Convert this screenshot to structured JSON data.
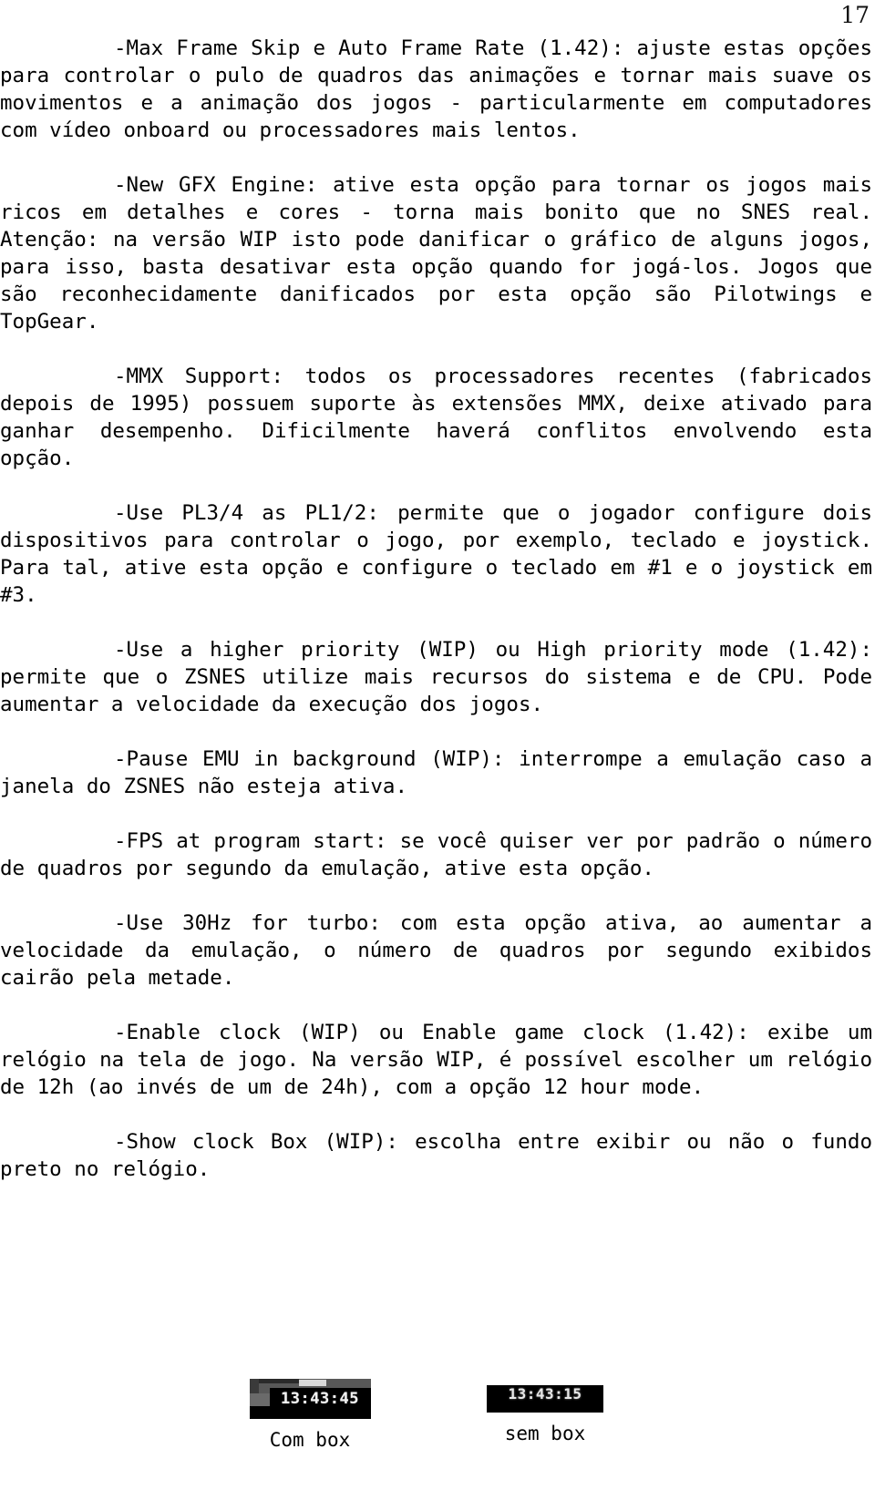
{
  "page": {
    "number": "17"
  },
  "paragraphs": [
    {
      "id": "max-frame-skip",
      "text": "-Max Frame Skip e Auto Frame Rate (1.42): ajuste estas opções para controlar o pulo de quadros das animações e tornar mais suave os movimentos e a animação dos jogos - particularmente em computadores com vídeo onboard ou processadores mais lentos."
    },
    {
      "id": "new-gfx-engine",
      "text": "-New GFX Engine: ative esta opção para tornar os jogos mais ricos em detalhes e cores - torna mais bonito que no SNES real. Atenção: na versão WIP isto pode danificar o gráfico de alguns jogos, para isso, basta desativar esta opção quando for jogá-los. Jogos que são reconhecidamente danificados por esta opção são Pilotwings e TopGear."
    },
    {
      "id": "mmx-support",
      "text": "-MMX Support: todos os processadores recentes (fabricados depois de 1995) possuem suporte às extensões MMX, deixe ativado para ganhar desempenho. Dificilmente haverá conflitos envolvendo esta opção."
    },
    {
      "id": "use-pl34-as-pl12",
      "text": "-Use PL3/4 as PL1/2: permite que o jogador configure dois dispositivos para controlar o jogo, por exemplo, teclado e joystick. Para tal, ative esta opção e configure o teclado em #1 e o joystick em #3."
    },
    {
      "id": "higher-priority",
      "text": "-Use a higher priority (WIP) ou High priority mode (1.42): permite que o ZSNES utilize mais recursos do sistema e de CPU. Pode aumentar a velocidade da execução dos jogos."
    },
    {
      "id": "pause-emu-background",
      "text": "-Pause EMU in background (WIP): interrompe a emulação caso a janela do ZSNES não esteja ativa."
    },
    {
      "id": "fps-at-program-start",
      "text": "-FPS at program start: se você quiser ver por padrão o número de quadros por segundo da emulação, ative esta opção."
    },
    {
      "id": "use-30hz-for-turbo",
      "text": "-Use 30Hz for turbo: com esta opção ativa, ao aumentar a velocidade da emulação, o número de quadros por segundo exibidos cairão pela metade."
    },
    {
      "id": "enable-clock",
      "text": "-Enable clock (WIP) ou Enable game clock (1.42): exibe um relógio na tela de jogo. Na versão WIP, é possível escolher um relógio de 12h (ao invés de um de 24h), com a opção 12 hour mode."
    },
    {
      "id": "show-clock-box",
      "text": "-Show clock Box (WIP): escolha entre exibir ou não o fundo preto no relógio."
    }
  ],
  "figures": [
    {
      "id": "com-box",
      "clock_time": "13:43:45",
      "caption": "Com box"
    },
    {
      "id": "sem-box",
      "clock_time": "13:43:15",
      "caption": "sem box"
    }
  ]
}
